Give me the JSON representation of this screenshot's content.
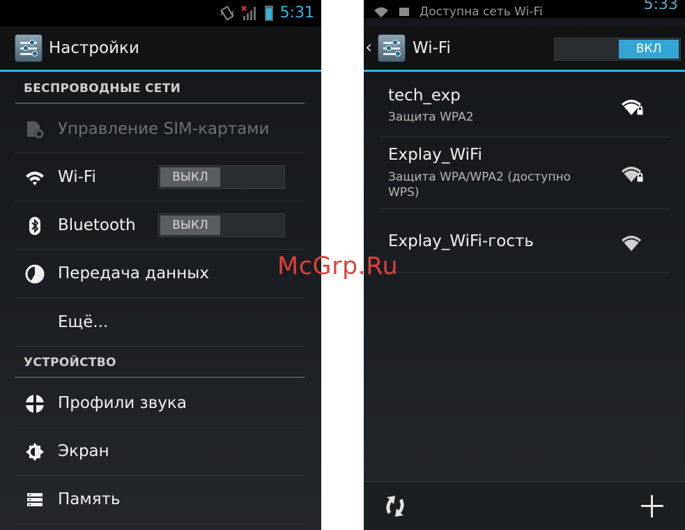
{
  "left_screen": {
    "status": {
      "time": "5:31"
    },
    "actionbar": {
      "title": "Настройки"
    },
    "sections": {
      "wireless": "БЕСПРОВОДНЫЕ СЕТИ",
      "device": "УСТРОЙСТВО"
    },
    "items": {
      "sim": {
        "label": "Управление SIM-картами",
        "icon": "sim-settings-icon",
        "disabled": true
      },
      "wifi": {
        "label": "Wi-Fi",
        "icon": "wifi-icon",
        "toggle": "ВЫКЛ"
      },
      "bluetooth": {
        "label": "Bluetooth",
        "icon": "bluetooth-icon",
        "toggle": "ВЫКЛ"
      },
      "data": {
        "label": "Передача данных",
        "icon": "data-usage-icon"
      },
      "more": {
        "label": "Ещё..."
      },
      "sound": {
        "label": "Профили звука",
        "icon": "sound-profiles-icon"
      },
      "display": {
        "label": "Экран",
        "icon": "display-icon"
      },
      "storage": {
        "label": "Память",
        "icon": "storage-icon"
      }
    }
  },
  "right_screen": {
    "status": {
      "time": "5:33",
      "notification": "Доступна сеть Wi-Fi"
    },
    "actionbar": {
      "title": "Wi-Fi",
      "toggle": "ВКЛ"
    },
    "networks": [
      {
        "name": "tech_exp",
        "security": "Защита WPA2",
        "locked": true
      },
      {
        "name": "Explay_WiFi",
        "security": "Защита WPA/WPA2 (доступно WPS)",
        "locked": true
      },
      {
        "name": "Explay_WiFi-гость",
        "security": "",
        "locked": false
      }
    ],
    "bottom_actions": [
      "scan-icon",
      "add-network-icon"
    ]
  },
  "watermark": "McGrp.Ru",
  "colors": {
    "accent": "#33b5e5",
    "watermark": "#e0403a"
  }
}
